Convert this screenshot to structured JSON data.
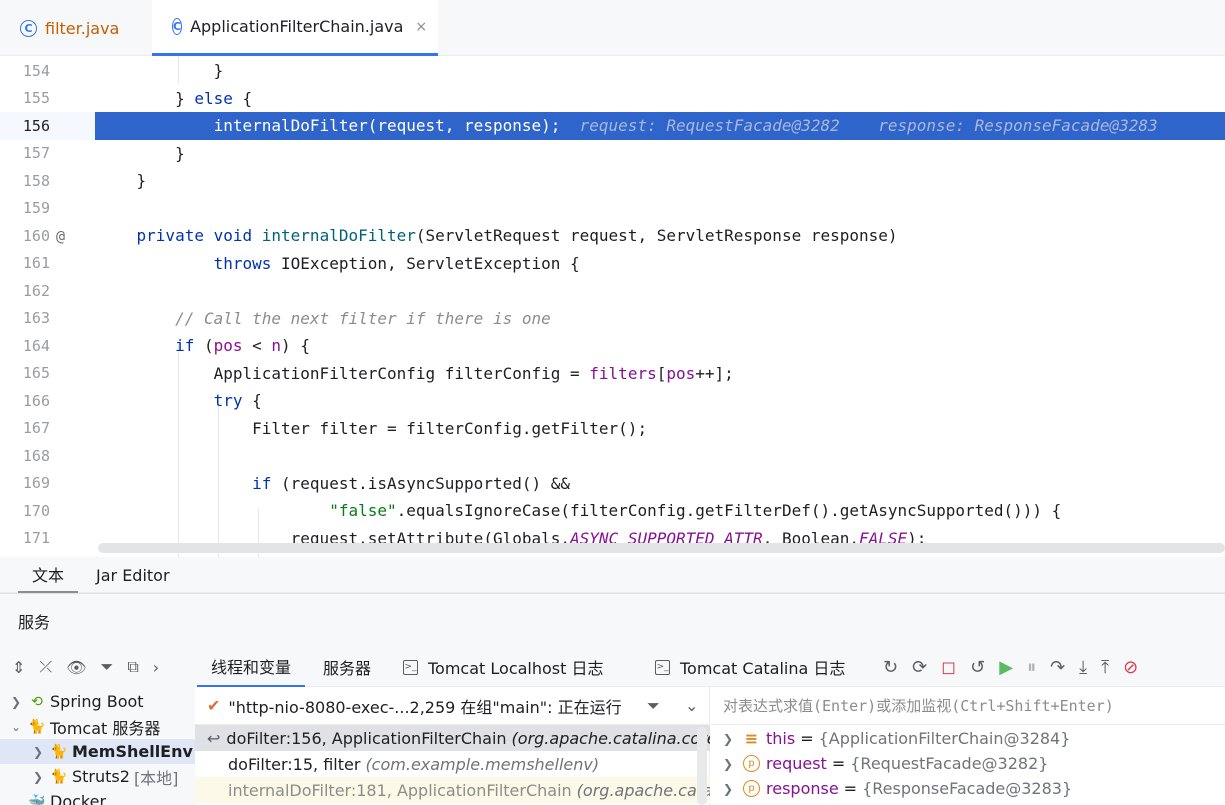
{
  "editor_tabs": [
    {
      "label": "filter.java",
      "icon": "class-icon",
      "active": false
    },
    {
      "label": "ApplicationFilterChain.java",
      "icon": "class-icon",
      "active": true,
      "close": "×"
    }
  ],
  "gutter_marker_160": "@",
  "code_lines": [
    {
      "num": "154",
      "text": "            }"
    },
    {
      "num": "155",
      "text": "        } else {"
    },
    {
      "num": "156",
      "text": "            internalDoFilter(request, response);",
      "inlay": "  request: RequestFacade@3282    response: ResponseFacade@3283"
    },
    {
      "num": "157",
      "text": "        }"
    },
    {
      "num": "158",
      "text": "    }"
    },
    {
      "num": "159",
      "text": ""
    },
    {
      "num": "160",
      "text": "    private void internalDoFilter(ServletRequest request, ServletResponse response)"
    },
    {
      "num": "161",
      "text": "            throws IOException, ServletException {"
    },
    {
      "num": "162",
      "text": ""
    },
    {
      "num": "163",
      "text": "        // Call the next filter if there is one"
    },
    {
      "num": "164",
      "text": "        if (pos < n) {"
    },
    {
      "num": "165",
      "text": "            ApplicationFilterConfig filterConfig = filters[pos++];"
    },
    {
      "num": "166",
      "text": "            try {"
    },
    {
      "num": "167",
      "text": "                Filter filter = filterConfig.getFilter();"
    },
    {
      "num": "168",
      "text": ""
    },
    {
      "num": "169",
      "text": "                if (request.isAsyncSupported() &&"
    },
    {
      "num": "170",
      "text": "                        \"false\".equalsIgnoreCase(filterConfig.getFilterDef().getAsyncSupported())) {"
    },
    {
      "num": "171",
      "text": "                    request.setAttribute(Globals.ASYNC_SUPPORTED_ATTR, Boolean.FALSE);"
    }
  ],
  "view_tabs": [
    {
      "label": "文本",
      "active": true
    },
    {
      "label": "Jar Editor",
      "active": false
    }
  ],
  "services": {
    "title": "服务",
    "tree": [
      {
        "label": "Spring Boot",
        "icon": "spring-boot-icon",
        "expanded": false
      },
      {
        "label": "Tomcat 服务器",
        "icon": "tomcat-icon",
        "expanded": true
      },
      {
        "label": "MemShellEnv",
        "icon": "tomcat-icon",
        "expanded": false,
        "selected": true
      },
      {
        "label": "Struts2",
        "suffix": "[本地]",
        "icon": "tomcat-icon",
        "expanded": false
      },
      {
        "label": "Docker",
        "icon": "docker-icon",
        "expanded": false
      }
    ],
    "debug_tabs": [
      {
        "label": "线程和变量",
        "active": true
      },
      {
        "label": "服务器",
        "active": false
      },
      {
        "label": "Tomcat Localhost 日志",
        "active": false
      },
      {
        "label": "Tomcat Catalina 日志",
        "active": false
      }
    ],
    "thread": "\"http-nio-8080-exec-...2,259 在组\"main\": 正在运行",
    "frames": [
      {
        "method": "doFilter:156, ApplicationFilterChain",
        "pkg": "(org.apache.catalina.core)",
        "selected": true
      },
      {
        "method": "doFilter:15, filter",
        "pkg": "(com.example.memshellenv)",
        "selected": false
      },
      {
        "method": "internalDoFilter:181, ApplicationFilterChain",
        "pkg": "(org.apache.catalina.core)",
        "dim": true
      }
    ],
    "eval_placeholder": "对表达式求值(Enter)或添加监视(Ctrl+Shift+Enter)",
    "variables": [
      {
        "name": "this",
        "value": "{ApplicationFilterChain@3284}",
        "icon": "field-icon"
      },
      {
        "name": "request",
        "value": "{RequestFacade@3282}",
        "icon": "parameter-icon"
      },
      {
        "name": "response",
        "value": "{ResponseFacade@3283}",
        "icon": "parameter-icon"
      }
    ]
  }
}
